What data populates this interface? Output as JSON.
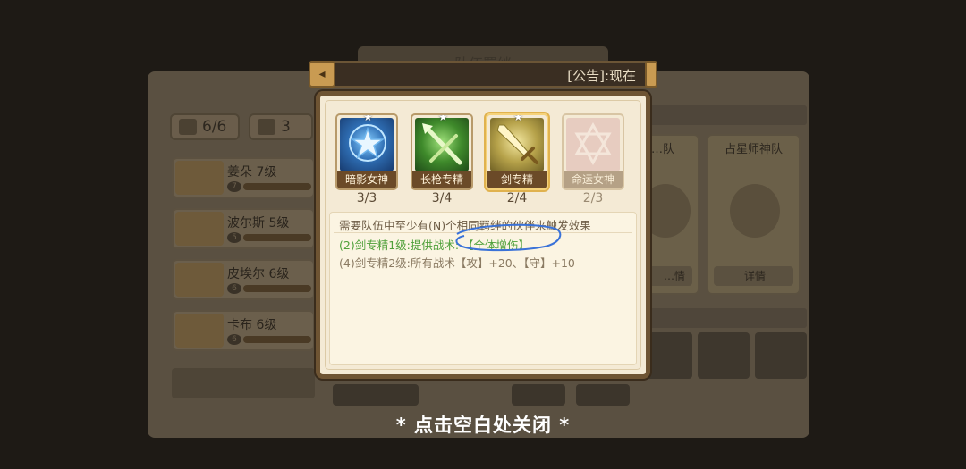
{
  "background": {
    "header_title": "队伍羁绊",
    "tabs": [
      {
        "label": "6/6",
        "icon": "sword-icon"
      },
      {
        "label": "3",
        "icon": "sword-icon"
      }
    ],
    "heroes": [
      {
        "name": "姜朵 7级",
        "level": "7"
      },
      {
        "name": "波尔斯 5级",
        "level": "5"
      },
      {
        "name": "皮埃尔 6级",
        "level": "6"
      },
      {
        "name": "卡布 6级",
        "level": "6"
      }
    ],
    "teams": [
      {
        "name": "…队",
        "detail": "…情"
      },
      {
        "name": "占星师神队",
        "detail": "详情"
      }
    ]
  },
  "announcement": {
    "text": "[公告]:现在",
    "nav_icon": "back-arrow-icon"
  },
  "bonds": [
    {
      "name": "暗影女神",
      "count": "3/3",
      "icon": "star-icon",
      "state": "active"
    },
    {
      "name": "长枪专精",
      "count": "3/4",
      "icon": "spear-icon",
      "state": "active"
    },
    {
      "name": "剑专精",
      "count": "2/4",
      "icon": "sword-icon",
      "state": "selected"
    },
    {
      "name": "命运女神",
      "count": "2/3",
      "icon": "hexagram-icon",
      "state": "inactive"
    }
  ],
  "description": {
    "requirement": "需要队伍中至少有(N)个相同羁绊的伙伴来触发效果",
    "tier1": "(2)剑专精1级:提供战术: 【全体增伤】",
    "tier2": "(4)剑专精2级:所有战术【攻】+20、【守】+10"
  },
  "colors": {
    "active_tier": "#4fa03a",
    "inactive_tier": "#8a7a62",
    "annotation_circle": "#3a72d8"
  },
  "close_hint": "* 点击空白处关闭 *"
}
